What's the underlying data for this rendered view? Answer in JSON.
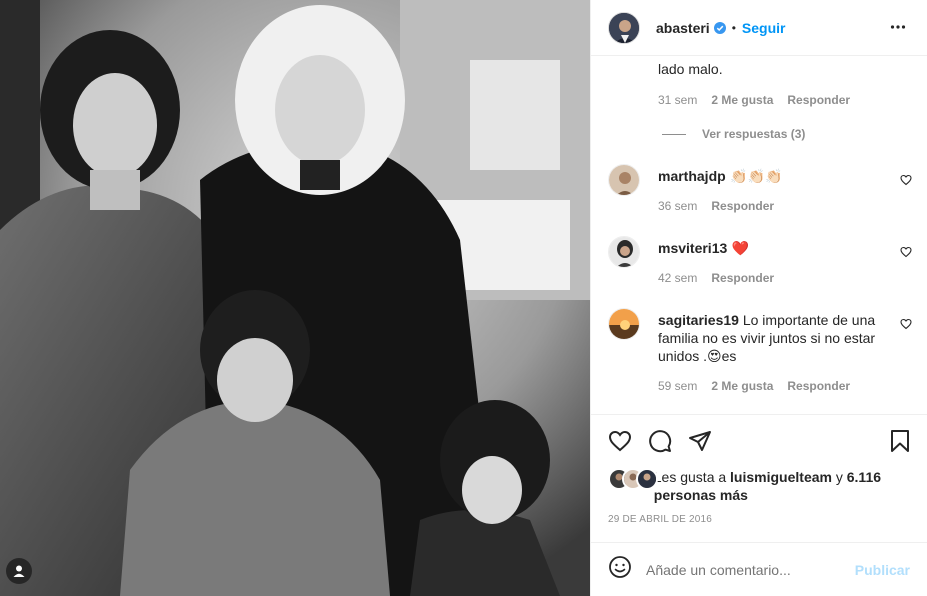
{
  "post": {
    "author": "abasteri",
    "follow_label": "Seguir",
    "dot": "•",
    "photo_alt": "Black and white family photo"
  },
  "comments": {
    "partial_text": "lado malo.",
    "partial_time": "31 sem",
    "partial_likes": "2 Me gusta",
    "partial_reply": "Responder",
    "view_replies": "Ver respuestas (3)",
    "items": [
      {
        "user": "marthajdp",
        "text": "👏🏻👏🏻👏🏻",
        "time": "36 sem",
        "likes": "",
        "reply": "Responder"
      },
      {
        "user": "msviteri13",
        "text": "❤️",
        "time": "42 sem",
        "likes": "",
        "reply": "Responder"
      },
      {
        "user": "sagitaries19",
        "text": "Lo importante de una familia no es vivir juntos si no estar unidos .😍es",
        "time": "59 sem",
        "likes": "2 Me gusta",
        "reply": "Responder"
      }
    ]
  },
  "likes": {
    "prefix": "Les gusta a",
    "user": "luismiguelteam",
    "conj": "y",
    "others": "6.116 personas más"
  },
  "date": "29 de abril de 2016",
  "add_comment": {
    "placeholder": "Añade un comentario...",
    "publish_label": "Publicar"
  },
  "colors": {
    "link": "#0095f6",
    "publish_disabled": "#b2dffc",
    "muted": "#8e8e8e",
    "heart_red": "#ed4956"
  },
  "icons": [
    "verified-badge-icon",
    "more-options-icon",
    "heart-icon",
    "comment-icon",
    "share-icon",
    "bookmark-icon",
    "emoji-icon",
    "user-tag-icon"
  ]
}
